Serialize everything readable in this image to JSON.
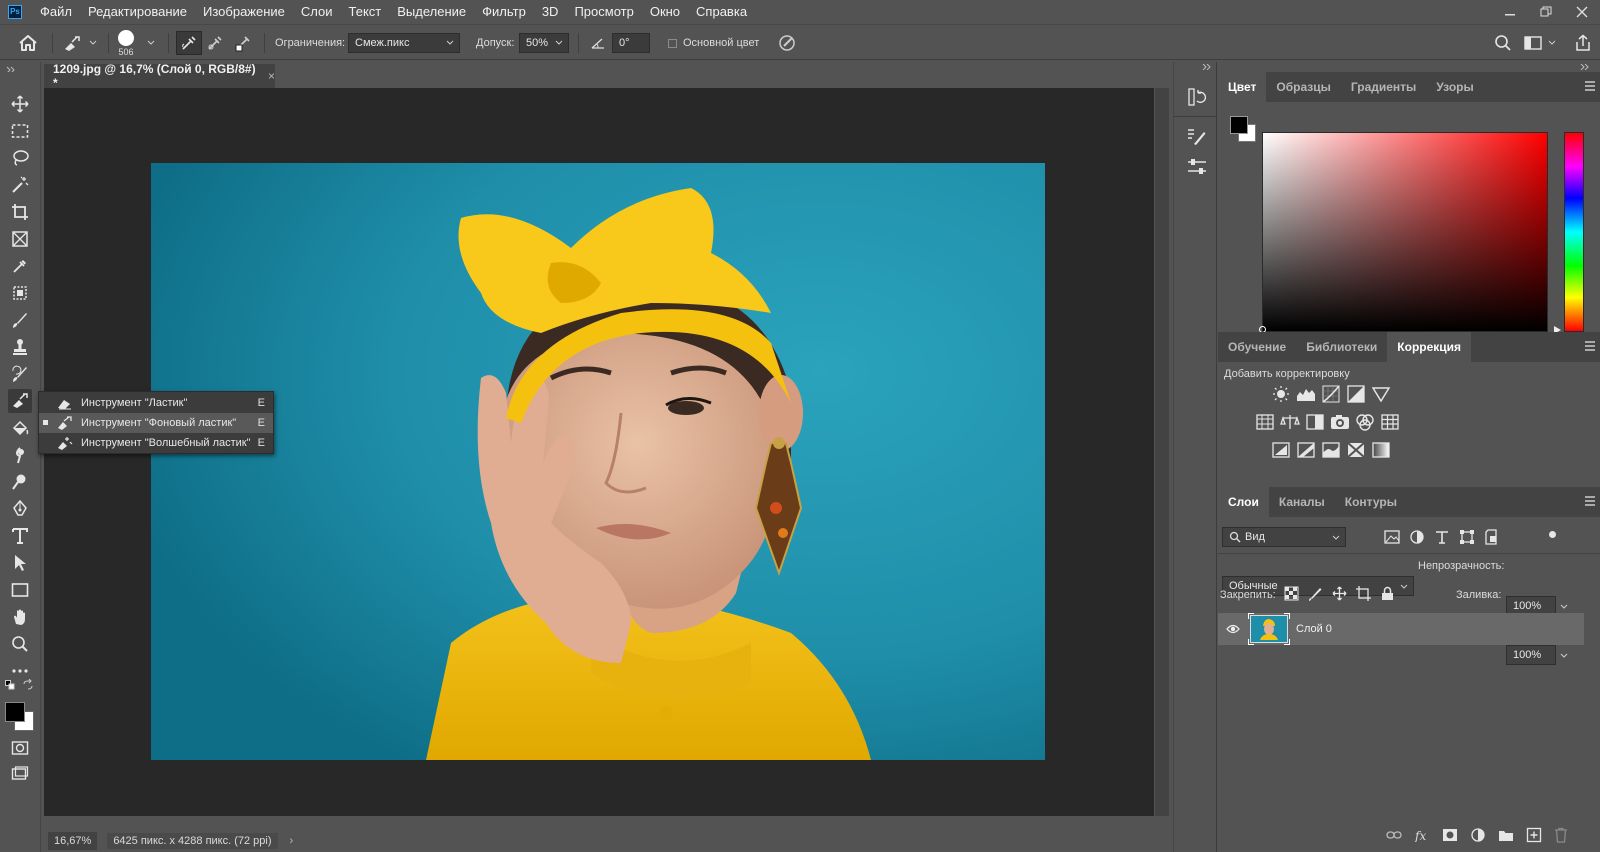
{
  "menubar": {
    "logo": "Ps",
    "items": [
      "Файл",
      "Редактирование",
      "Изображение",
      "Слои",
      "Текст",
      "Выделение",
      "Фильтр",
      "3D",
      "Просмотр",
      "Окно",
      "Справка"
    ]
  },
  "options": {
    "brush_size": "506",
    "constraints_label": "Ограничения:",
    "constraints_value": "Смеж.пикс",
    "tolerance_label": "Допуск:",
    "tolerance_value": "50%",
    "angle_value": "0°",
    "foreground_checkbox_label": "Основной цвет"
  },
  "document": {
    "tab_title": "1209.jpg @ 16,7% (Слой 0, RGB/8#) *",
    "close": "×"
  },
  "flyout": {
    "items": [
      {
        "label": "Инструмент \"Ластик\"",
        "key": "E",
        "selected": false
      },
      {
        "label": "Инструмент \"Фоновый ластик\"",
        "key": "E",
        "selected": true
      },
      {
        "label": "Инструмент \"Волшебный ластик\"",
        "key": "E",
        "selected": false
      }
    ]
  },
  "status": {
    "zoom": "16,67%",
    "dimensions": "6425 пикс. x 4288 пикс. (72 ppi)",
    "arrow": "›"
  },
  "color_panel": {
    "tabs": [
      "Цвет",
      "Образцы",
      "Градиенты",
      "Узоры"
    ],
    "active_tab": "Цвет",
    "foreground": "#000000",
    "background": "#ffffff"
  },
  "adjust_panel": {
    "tabs": [
      "Обучение",
      "Библиотеки",
      "Коррекция"
    ],
    "active_tab": "Коррекция",
    "title": "Добавить корректировку"
  },
  "layers_panel": {
    "tabs": [
      "Слои",
      "Каналы",
      "Контуры"
    ],
    "active_tab": "Слои",
    "filter_value": "Вид",
    "blend_mode": "Обычные",
    "opacity_label": "Непрозрачность:",
    "opacity_value": "100%",
    "lock_label": "Закрепить:",
    "fill_label": "Заливка:",
    "fill_value": "100%",
    "layers": [
      {
        "name": "Слой 0",
        "visible": true
      }
    ]
  },
  "colors": {
    "accent": "#31a8ff",
    "canvas_bg": "#282828",
    "teal_bg": "#1f8fa8",
    "yellow": "#f5c518"
  }
}
